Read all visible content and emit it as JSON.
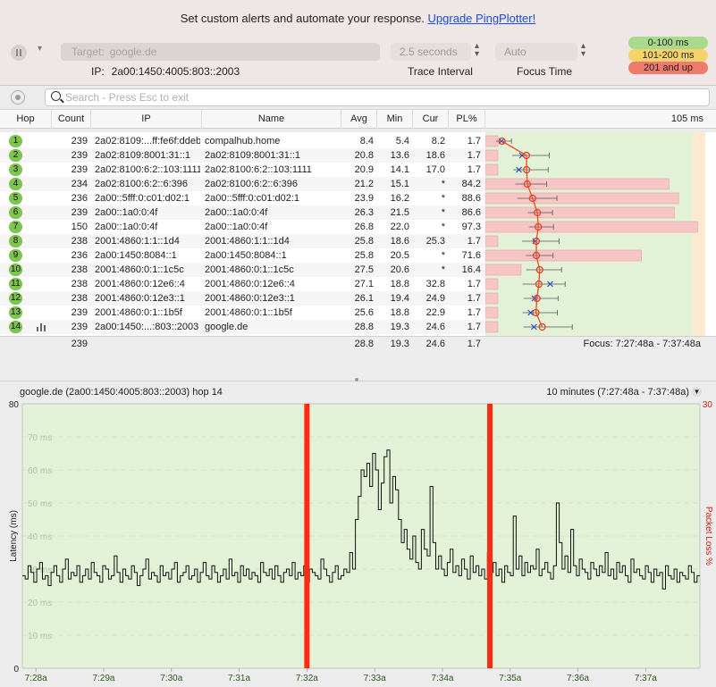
{
  "banner": {
    "text": "Set custom alerts and automate your response.",
    "link": "Upgrade PingPlotter!"
  },
  "toolbar": {
    "target_label": "Target:",
    "target_value": "google.de",
    "ip_label": "IP:",
    "ip_value": "2a00:1450:4005:803::2003",
    "interval_value": "2.5 seconds",
    "interval_label": "Trace Interval",
    "focus_value": "Auto",
    "focus_label": "Focus Time"
  },
  "legend": [
    {
      "label": "0-100 ms",
      "color": "#a9d98a"
    },
    {
      "label": "101-200 ms",
      "color": "#f6d26b"
    },
    {
      "label": "201 and up",
      "color": "#f07a6c"
    }
  ],
  "search": {
    "placeholder": "Search - Press Esc to exit"
  },
  "table": {
    "headers": {
      "hop": "Hop",
      "count": "Count",
      "ip": "IP",
      "name": "Name",
      "avg": "Avg",
      "min": "Min",
      "cur": "Cur",
      "pl": "PL%",
      "scale": "105 ms"
    },
    "scale_max_ms": 105,
    "rows": [
      {
        "hop": "1",
        "count": "239",
        "ip": "2a02:8109:...ff:fe6f:ddeb",
        "name": "compalhub.home",
        "avg": "8.4",
        "min": "5.4",
        "cur": "8.2",
        "pl": "1.7"
      },
      {
        "hop": "2",
        "count": "239",
        "ip": "2a02:8109:8001:31::1",
        "name": "2a02:8109:8001:31::1",
        "avg": "20.8",
        "min": "13.6",
        "cur": "18.6",
        "pl": "1.7"
      },
      {
        "hop": "3",
        "count": "239",
        "ip": "2a02:8100:6:2::103:1111",
        "name": "2a02:8100:6:2::103:1111",
        "avg": "20.9",
        "min": "14.1",
        "cur": "17.0",
        "pl": "1.7"
      },
      {
        "hop": "4",
        "count": "234",
        "ip": "2a02:8100:6:2::6:396",
        "name": "2a02:8100:6:2::6:396",
        "avg": "21.2",
        "min": "15.1",
        "cur": "*",
        "pl": "84.2"
      },
      {
        "hop": "5",
        "count": "236",
        "ip": "2a00::5fff:0:c01:d02:1",
        "name": "2a00::5fff:0:c01:d02:1",
        "avg": "23.9",
        "min": "16.2",
        "cur": "*",
        "pl": "88.6"
      },
      {
        "hop": "6",
        "count": "239",
        "ip": "2a00::1a0:0:4f",
        "name": "2a00::1a0:0:4f",
        "avg": "26.3",
        "min": "21.5",
        "cur": "*",
        "pl": "86.6"
      },
      {
        "hop": "7",
        "count": "150",
        "ip": "2a00::1a0:0:4f",
        "name": "2a00::1a0:0:4f",
        "avg": "26.8",
        "min": "22.0",
        "cur": "*",
        "pl": "97.3"
      },
      {
        "hop": "8",
        "count": "238",
        "ip": "2001:4860:1:1::1d4",
        "name": "2001:4860:1:1::1d4",
        "avg": "25.8",
        "min": "18.6",
        "cur": "25.3",
        "pl": "1.7"
      },
      {
        "hop": "9",
        "count": "236",
        "ip": "2a00:1450:8084::1",
        "name": "2a00:1450:8084::1",
        "avg": "25.8",
        "min": "20.5",
        "cur": "*",
        "pl": "71.6"
      },
      {
        "hop": "10",
        "count": "238",
        "ip": "2001:4860:0:1::1c5c",
        "name": "2001:4860:0:1::1c5c",
        "avg": "27.5",
        "min": "20.6",
        "cur": "*",
        "pl": "16.4"
      },
      {
        "hop": "11",
        "count": "238",
        "ip": "2001:4860:0:12e6::4",
        "name": "2001:4860:0:12e6::4",
        "avg": "27.1",
        "min": "18.8",
        "cur": "32.8",
        "pl": "1.7"
      },
      {
        "hop": "12",
        "count": "238",
        "ip": "2001:4860:0:12e3::1",
        "name": "2001:4860:0:12e3::1",
        "avg": "26.1",
        "min": "19.4",
        "cur": "24.9",
        "pl": "1.7"
      },
      {
        "hop": "13",
        "count": "239",
        "ip": "2001:4860:0:1::1b5f",
        "name": "2001:4860:0:1::1b5f",
        "avg": "25.6",
        "min": "18.8",
        "cur": "22.9",
        "pl": "1.7"
      },
      {
        "hop": "14",
        "count": "239",
        "ip": "2a00:1450:...:803::2003",
        "name": "google.de",
        "avg": "28.8",
        "min": "19.3",
        "cur": "24.6",
        "pl": "1.7"
      }
    ],
    "footer": {
      "count": "239",
      "avg": "28.8",
      "min": "19.3",
      "cur": "24.6",
      "pl": "1.7",
      "focus": "Focus: 7:27:48a - 7:37:48a"
    }
  },
  "chart_header": {
    "title": "google.de (2a00:1450:4005:803::2003) hop 14",
    "range": "10 minutes (7:27:48a - 7:37:48a)"
  },
  "chart_data": {
    "type": "line",
    "ylabel": "Latency (ms)",
    "y2label": "Packet Loss %",
    "ylim": [
      0,
      80
    ],
    "y2max": "30",
    "y_ticks": [
      "80",
      "0"
    ],
    "y_grid_labels": [
      "70 ms",
      "60 ms",
      "50 ms",
      "40 ms",
      "30 ms",
      "20 ms",
      "10 ms"
    ],
    "y_grid_values": [
      70,
      60,
      50,
      40,
      30,
      20,
      10
    ],
    "x_labels": [
      "7:28a",
      "7:29a",
      "7:30a",
      "7:31a",
      "7:32a",
      "7:33a",
      "7:34a",
      "7:35a",
      "7:36a",
      "7:37a"
    ],
    "x_start_minute": 27.8,
    "x_end_minute": 37.8,
    "loss_events_minute": [
      32.0,
      34.7
    ],
    "line_color": "#111111",
    "bg_color": "#e3f1d6",
    "loss_color": "#ff2a12",
    "series_minutes": 10,
    "latency": [
      28,
      27,
      31,
      29,
      26,
      30,
      32,
      27,
      28,
      25,
      29,
      31,
      28,
      26,
      30,
      33,
      27,
      29,
      28,
      31,
      26,
      28,
      30,
      27,
      32,
      29,
      28,
      26,
      31,
      30,
      27,
      28,
      34,
      29,
      26,
      30,
      28,
      27,
      31,
      29,
      25,
      28,
      30,
      33,
      27,
      29,
      28,
      26,
      31,
      28,
      29,
      27,
      30,
      32,
      26,
      28,
      29,
      31,
      27,
      28,
      30,
      26,
      29,
      32,
      28,
      27,
      31,
      29,
      26,
      28,
      30,
      27,
      33,
      28,
      29,
      26,
      31,
      28,
      30,
      27,
      29,
      28,
      26,
      32,
      29,
      28,
      30,
      27,
      31,
      28,
      26,
      29,
      30,
      28,
      32,
      27,
      29,
      28,
      31,
      26,
      30,
      29,
      28,
      27,
      33,
      30,
      28,
      26,
      29,
      31,
      27,
      28,
      30,
      29,
      35,
      30,
      45,
      52,
      60,
      58,
      62,
      55,
      65,
      60,
      48,
      56,
      64,
      66,
      50,
      58,
      54,
      45,
      38,
      42,
      36,
      33,
      40,
      32,
      30,
      42,
      36,
      34,
      55,
      38,
      30,
      34,
      30,
      28,
      32,
      36,
      29,
      31,
      28,
      33,
      30,
      27,
      34,
      29,
      31,
      28,
      30,
      27,
      35,
      29,
      32,
      28,
      30,
      26,
      31,
      29,
      28,
      46,
      30,
      34,
      28,
      32,
      29,
      31,
      30,
      36,
      28,
      30,
      32,
      29,
      27,
      31,
      50,
      38,
      30,
      34,
      29,
      42,
      31,
      28,
      33,
      30,
      29,
      27,
      32,
      30,
      28,
      31,
      29,
      35,
      28,
      30,
      27,
      32,
      29,
      31,
      28,
      26,
      33,
      29,
      30,
      28,
      27,
      31,
      29,
      26,
      30,
      28,
      29,
      24,
      31,
      28,
      27,
      30,
      26,
      29,
      28,
      27,
      31,
      29,
      26,
      28
    ]
  }
}
